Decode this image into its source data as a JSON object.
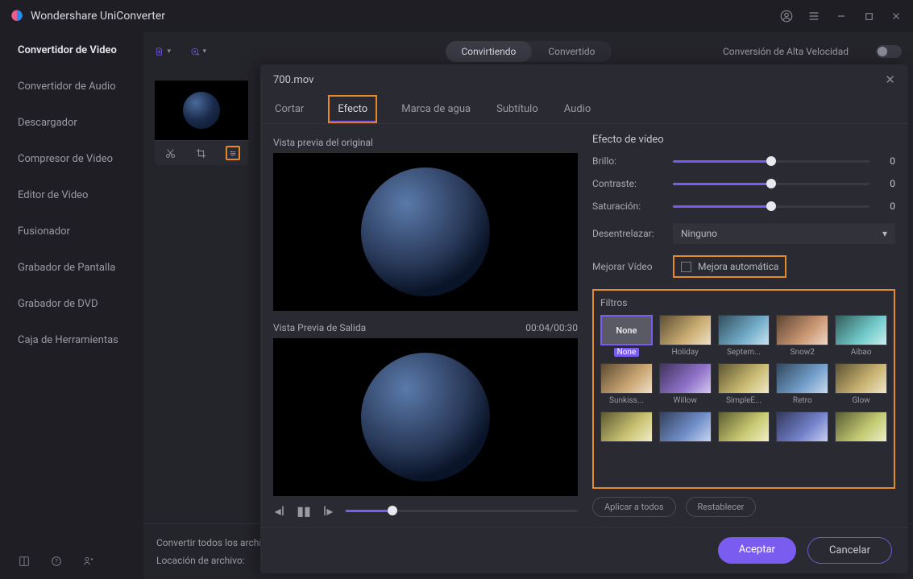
{
  "app": {
    "title": "Wondershare UniConverter"
  },
  "sidebar": {
    "items": [
      {
        "label": "Convertidor de Video"
      },
      {
        "label": "Convertidor de Audio"
      },
      {
        "label": "Descargador"
      },
      {
        "label": "Compresor de Video"
      },
      {
        "label": "Editor de Video"
      },
      {
        "label": "Fusionador"
      },
      {
        "label": "Grabador de Pantalla"
      },
      {
        "label": "Grabador de DVD"
      },
      {
        "label": "Caja de Herramientas"
      }
    ]
  },
  "topbar": {
    "toggle_a": "Convirtiendo",
    "toggle_b": "Convertido",
    "hs_label": "Conversión de Alta Velocidad"
  },
  "bottom": {
    "line1": "Convertir todos los archivos",
    "line2": "Locación de archivo:"
  },
  "modal": {
    "filename": "700.mov",
    "tabs": {
      "cortar": "Cortar",
      "efecto": "Efecto",
      "marca": "Marca de agua",
      "subtitulo": "Subtítulo",
      "audio": "Audio"
    },
    "preview_orig": "Vista previa del original",
    "preview_out": "Vista Previa de Salida",
    "timecode": "00:04/00:30",
    "section_effect": "Efecto de vídeo",
    "sliders": {
      "brillo": {
        "label": "Brillo:",
        "val": "0"
      },
      "contraste": {
        "label": "Contraste:",
        "val": "0"
      },
      "saturacion": {
        "label": "Saturación:",
        "val": "0"
      }
    },
    "deinterlace": {
      "label": "Desentrelazar:",
      "value": "Ninguno"
    },
    "enhance": {
      "label": "Mejorar Vídeo",
      "check": "Mejora automática"
    },
    "filters_title": "Filtros",
    "filters": [
      {
        "name": "None",
        "sel": true
      },
      {
        "name": "Holiday"
      },
      {
        "name": "Septem..."
      },
      {
        "name": "Snow2"
      },
      {
        "name": "Aibao"
      },
      {
        "name": "Sunkiss..."
      },
      {
        "name": "Willow"
      },
      {
        "name": "SimpleE..."
      },
      {
        "name": "Retro"
      },
      {
        "name": "Glow"
      },
      {
        "name": ""
      },
      {
        "name": ""
      },
      {
        "name": ""
      },
      {
        "name": ""
      },
      {
        "name": ""
      }
    ],
    "apply_all": "Aplicar a todos",
    "reset": "Restablecer",
    "ok": "Aceptar",
    "cancel": "Cancelar"
  }
}
